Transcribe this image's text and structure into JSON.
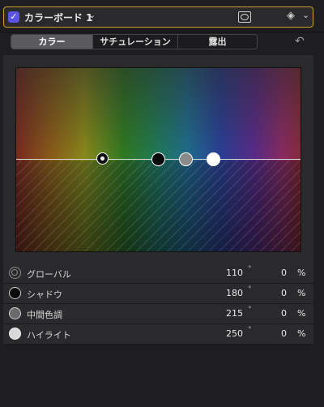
{
  "header": {
    "board_title": "カラーボード 1",
    "chevron": "⌄",
    "key_icon": "keyframe-icon",
    "mask_icon": "mask-icon",
    "accent": "#c9a227",
    "checkbox_color": "#5b53e8"
  },
  "tabs": [
    {
      "label": "カラー",
      "active": true
    },
    {
      "label": "サチュレーション",
      "active": false
    },
    {
      "label": "露出",
      "active": false
    }
  ],
  "reset_glyph": "↶",
  "rows": [
    {
      "label": "グローバル",
      "angle": "110",
      "deg": "°",
      "value": "0",
      "unit": "%"
    },
    {
      "label": "シャドウ",
      "angle": "180",
      "deg": "°",
      "value": "0",
      "unit": "%"
    },
    {
      "label": "中間色調",
      "angle": "215",
      "deg": "°",
      "value": "0",
      "unit": "%"
    },
    {
      "label": "ハイライト",
      "angle": "250",
      "deg": "°",
      "value": "0",
      "unit": "%"
    }
  ]
}
